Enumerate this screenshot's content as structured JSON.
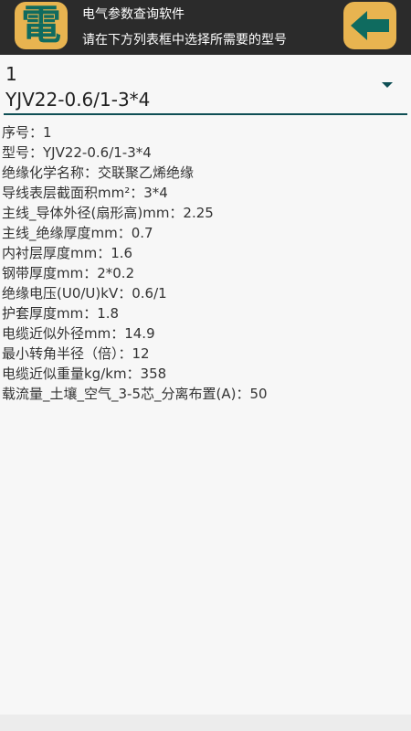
{
  "header": {
    "logo_text": "電",
    "title": "电气参数查询软件",
    "subtitle": "请在下方列表框中选择所需要的型号"
  },
  "spinner": {
    "selected_id": "1",
    "selected_model": "YJV22-0.6/1-3*4"
  },
  "details": [
    "序号：1",
    "型号：YJV22-0.6/1-3*4",
    "绝缘化学名称：交联聚乙烯绝缘",
    "导线表层截面积mm²：3*4",
    "主线_导体外径(扇形高)mm：2.25",
    "主线_绝缘厚度mm：0.7",
    "内衬层厚度mm：1.6",
    "钢带厚度mm：2*0.2",
    "绝缘电压(U0/U)kV：0.6/1",
    "护套厚度mm：1.8",
    "电缆近似外径mm：14.9",
    "最小转角半径（倍）：12",
    "电缆近似重量kg/km：358",
    "载流量_土壤_空气_3-5芯_分离布置(A)：50"
  ],
  "icons": {
    "back": "arrow-left-icon"
  },
  "colors": {
    "header_bg": "#2b2b2b",
    "badge_bg": "#e8b450",
    "accent": "#0f6b5f",
    "underline": "#0f4f55",
    "background": "#f7f7f7"
  }
}
